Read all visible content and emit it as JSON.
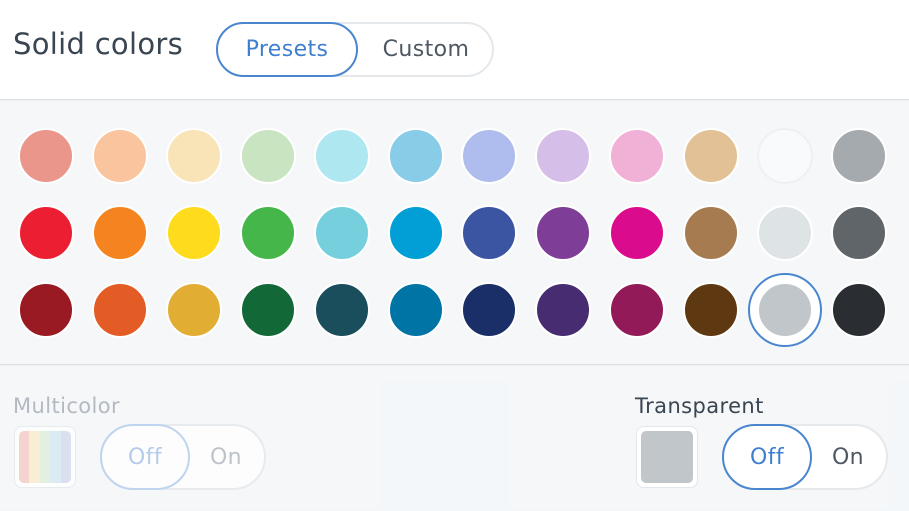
{
  "header": {
    "title": "Solid colors",
    "tabs": [
      {
        "label": "Presets",
        "active": true
      },
      {
        "label": "Custom",
        "active": false
      }
    ]
  },
  "palette": {
    "selected_color": "#C1C6CB",
    "rows": [
      [
        "#EB968A",
        "#FAC59E",
        "#F9E4B8",
        "#C8E4C1",
        "#AEE7EF",
        "#88CCE8",
        "#AFBDEE",
        "#D5BFE8",
        "#F1B1D6",
        "#E2C196",
        "#F9FAFB",
        "#A5AAAF"
      ],
      [
        "#EC1E31",
        "#F58420",
        "#FEDC1D",
        "#45B649",
        "#76CFDD",
        "#019FD6",
        "#3C55A2",
        "#7E3D96",
        "#DA0C8D",
        "#A77B50",
        "#DEE3E6",
        "#5F6569"
      ],
      [
        "#991A22",
        "#E45C25",
        "#E2AD33",
        "#126937",
        "#1A4E5D",
        "#0174A6",
        "#1A2E68",
        "#472C71",
        "#921A58",
        "#5E3811",
        "#C1C6CB",
        "#2A2E32"
      ]
    ]
  },
  "multicolor": {
    "label": "Multicolor",
    "off_label": "Off",
    "on_label": "On",
    "stripes": [
      "#F5C9C2",
      "#F9EBC7",
      "#DDEED7",
      "#D3E8F2",
      "#D4D7EC"
    ]
  },
  "transparent": {
    "label": "Transparent",
    "off_label": "Off",
    "on_label": "On",
    "preview_color": "#C1C6CB"
  },
  "colors": {
    "accent": "#4A86CF",
    "text": "#3A4552",
    "muted": "#B3BAC1"
  }
}
